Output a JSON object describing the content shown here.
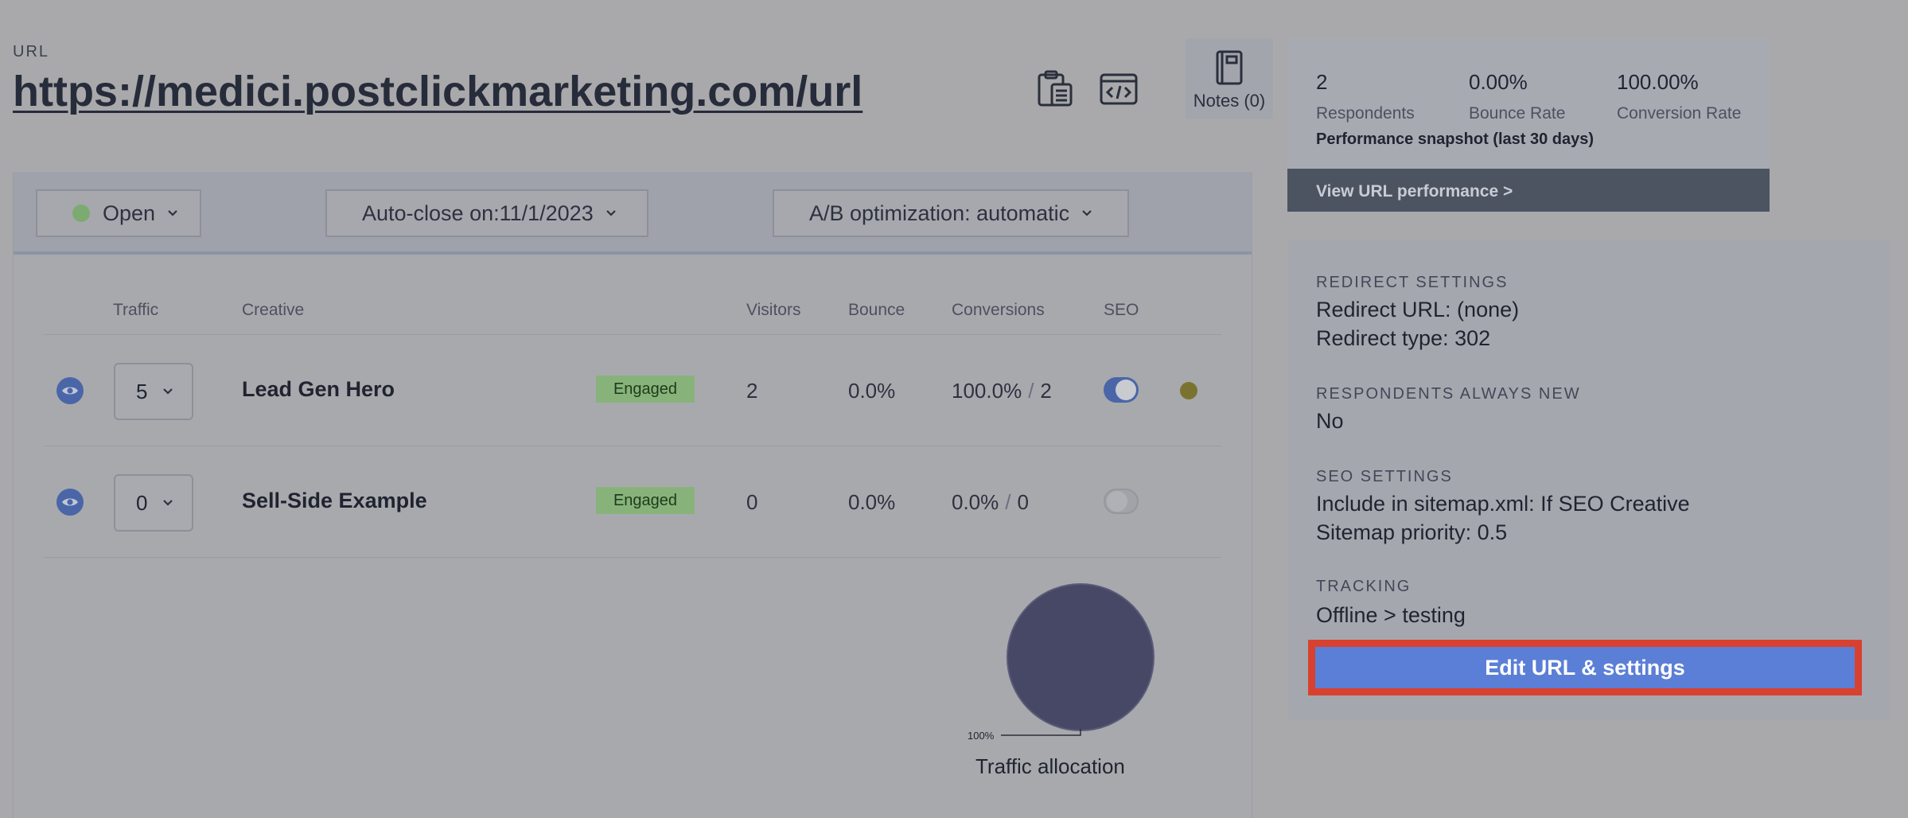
{
  "header": {
    "url_label": "URL",
    "url": "https://medici.postclickmarketing.com/url",
    "notes_label": "Notes (0)",
    "icons": [
      "clipboard-icon",
      "embed-code-icon",
      "notebook-icon"
    ]
  },
  "performance": {
    "stats": [
      {
        "value": "2",
        "label": "Respondents"
      },
      {
        "value": "0.00%",
        "label": "Bounce Rate"
      },
      {
        "value": "100.00%",
        "label": "Conversion Rate"
      }
    ],
    "snapshot_label": "Performance snapshot (last 30 days)",
    "view_link": "View URL performance >"
  },
  "settings": {
    "redirect_heading": "REDIRECT SETTINGS",
    "redirect_url": "Redirect URL: (none)",
    "redirect_type": "Redirect type: 302",
    "respondents_heading": "RESPONDENTS ALWAYS NEW",
    "respondents_value": "No",
    "seo_heading": "SEO SETTINGS",
    "sitemap_include": "Include in sitemap.xml: If SEO Creative",
    "sitemap_priority": "Sitemap priority: 0.5",
    "tracking_heading": "TRACKING",
    "tracking_value": "Offline > testing",
    "edit_button": "Edit URL & settings"
  },
  "filters": {
    "status": "Open",
    "auto_close": "Auto-close on:11/1/2023",
    "ab_optimization": "A/B optimization: automatic"
  },
  "table": {
    "columns": [
      "Traffic",
      "Creative",
      "Visitors",
      "Bounce",
      "Conversions",
      "SEO"
    ],
    "rows": [
      {
        "traffic": "5",
        "creative": "Lead Gen Hero",
        "status": "Engaged",
        "visitors": "2",
        "bounce": "0.0%",
        "conversion_rate": "100.0%",
        "conversions": "2",
        "seo": true
      },
      {
        "traffic": "0",
        "creative": "Sell-Side Example",
        "status": "Engaged",
        "visitors": "0",
        "bounce": "0.0%",
        "conversion_rate": "0.0%",
        "conversions": "0",
        "seo": false
      }
    ]
  },
  "chart_data": {
    "type": "pie",
    "title": "Traffic allocation",
    "categories": [
      "Lead Gen Hero"
    ],
    "values": [
      100
    ],
    "slice_labels": [
      "100%"
    ]
  },
  "colors": {
    "accent_blue": "#5b7fd6",
    "highlight_red": "#d8412f",
    "engaged_green": "#87b37a",
    "pie_fill": "#474866"
  }
}
